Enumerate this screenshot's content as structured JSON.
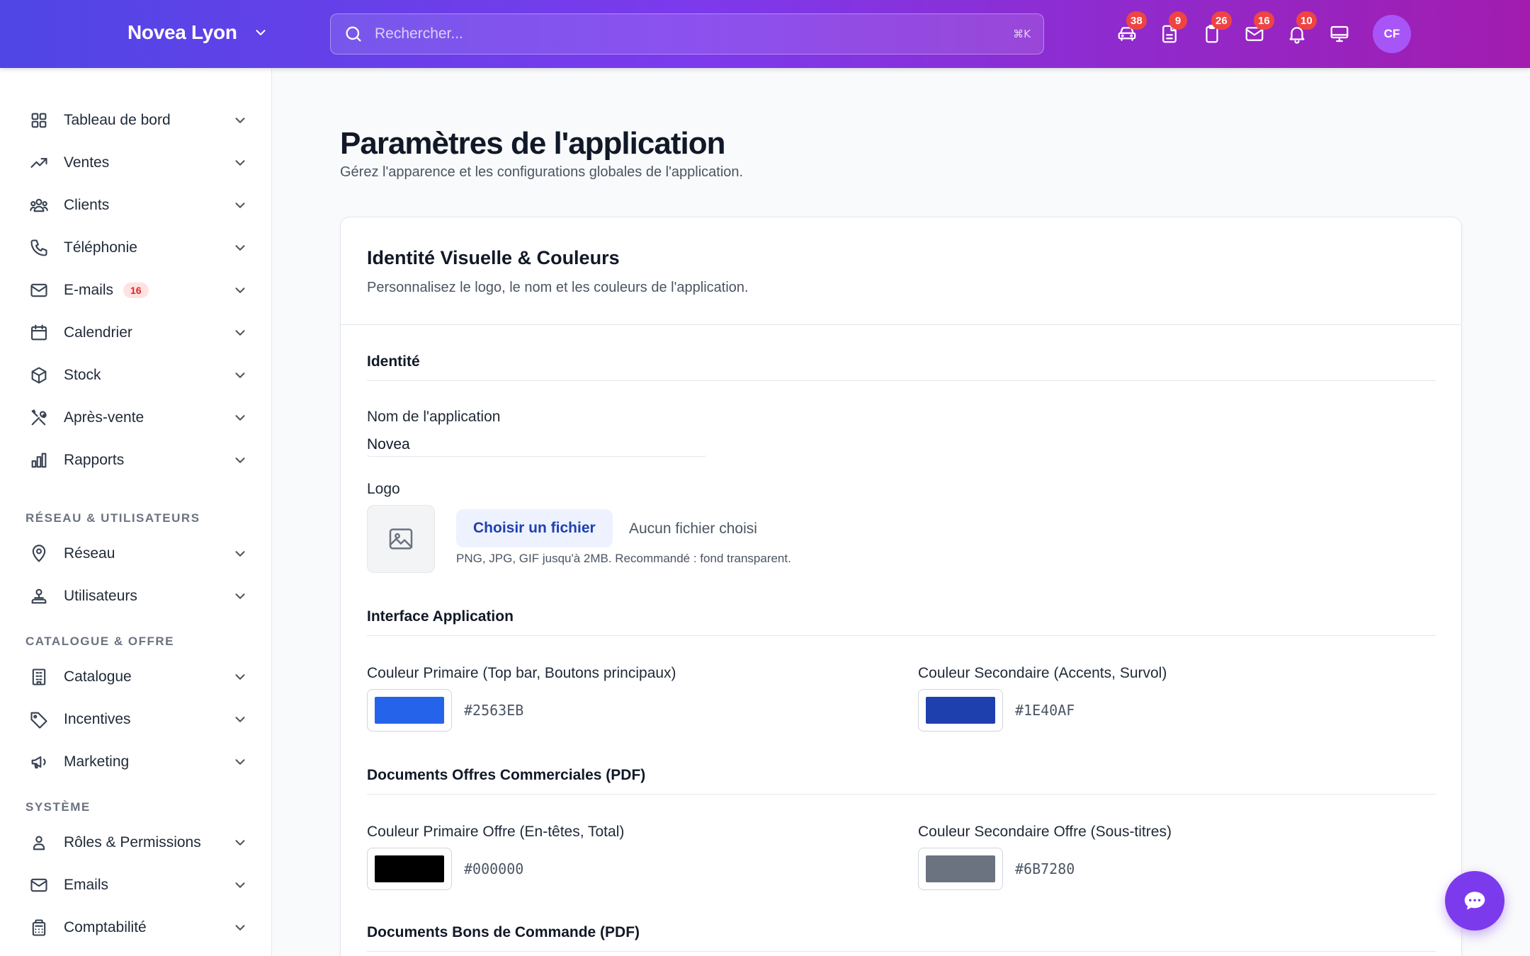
{
  "topbar": {
    "brand": "Novea Lyon",
    "search_placeholder": "Rechercher...",
    "search_shortcut": "⌘K",
    "icons": [
      {
        "name": "car-icon",
        "badge": "38"
      },
      {
        "name": "document-icon",
        "badge": "9"
      },
      {
        "name": "clipboard-icon",
        "badge": "26"
      },
      {
        "name": "mail-icon",
        "badge": "16"
      },
      {
        "name": "bell-icon",
        "badge": "10"
      },
      {
        "name": "monitor-icon",
        "badge": ""
      }
    ],
    "avatar": "CF"
  },
  "sidebar": {
    "items": [
      {
        "label": "Tableau de bord",
        "icon": "grid-icon"
      },
      {
        "label": "Ventes",
        "icon": "trend-icon"
      },
      {
        "label": "Clients",
        "icon": "users-icon"
      },
      {
        "label": "Téléphonie",
        "icon": "phone-icon"
      },
      {
        "label": "E-mails",
        "icon": "mail-icon",
        "badge": "16"
      },
      {
        "label": "Calendrier",
        "icon": "calendar-icon"
      },
      {
        "label": "Stock",
        "icon": "box-icon"
      },
      {
        "label": "Après-vente",
        "icon": "tools-icon"
      },
      {
        "label": "Rapports",
        "icon": "chart-icon"
      }
    ],
    "section_network": "RÉSEAU & UTILISATEURS",
    "network_items": [
      {
        "label": "Réseau",
        "icon": "pin-icon"
      },
      {
        "label": "Utilisateurs",
        "icon": "user-network-icon"
      }
    ],
    "section_catalogue": "CATALOGUE & OFFRE",
    "catalogue_items": [
      {
        "label": "Catalogue",
        "icon": "building-icon"
      },
      {
        "label": "Incentives",
        "icon": "tag-icon"
      },
      {
        "label": "Marketing",
        "icon": "megaphone-icon"
      }
    ],
    "section_system": "SYSTÈME",
    "system_items": [
      {
        "label": "Rôles & Permissions",
        "icon": "user-icon"
      },
      {
        "label": "Emails",
        "icon": "mail-icon"
      },
      {
        "label": "Comptabilité",
        "icon": "calculator-icon"
      }
    ]
  },
  "page": {
    "title": "Paramètres de l'application",
    "subtitle": "Gérez l'apparence et les configurations globales de l'application."
  },
  "card": {
    "title": "Identité Visuelle & Couleurs",
    "subtitle": "Personnalisez le logo, le nom et les couleurs de l'application.",
    "section_identity": "Identité",
    "app_name_label": "Nom de l'application",
    "app_name_value": "Novea",
    "logo_label": "Logo",
    "file_button": "Choisir un fichier",
    "file_status": "Aucun fichier choisi",
    "file_hint": "PNG, JPG, GIF jusqu'à 2MB. Recommandé : fond transparent.",
    "section_interface": "Interface Application",
    "primary_label": "Couleur Primaire (Top bar, Boutons principaux)",
    "primary_value": "#2563EB",
    "secondary_label": "Couleur Secondaire (Accents, Survol)",
    "secondary_value": "#1E40AF",
    "section_offers": "Documents Offres Commerciales (PDF)",
    "offer_primary_label": "Couleur Primaire Offre (En-têtes, Total)",
    "offer_primary_value": "#000000",
    "offer_secondary_label": "Couleur Secondaire Offre (Sous-titres)",
    "offer_secondary_value": "#6B7280",
    "section_orders": "Documents Bons de Commande (PDF)"
  },
  "colors": {
    "topbar_start": "#4f46e5",
    "topbar_end": "#a21caf",
    "badge": "#ef4444",
    "chat_fab": "#7c3aed"
  }
}
